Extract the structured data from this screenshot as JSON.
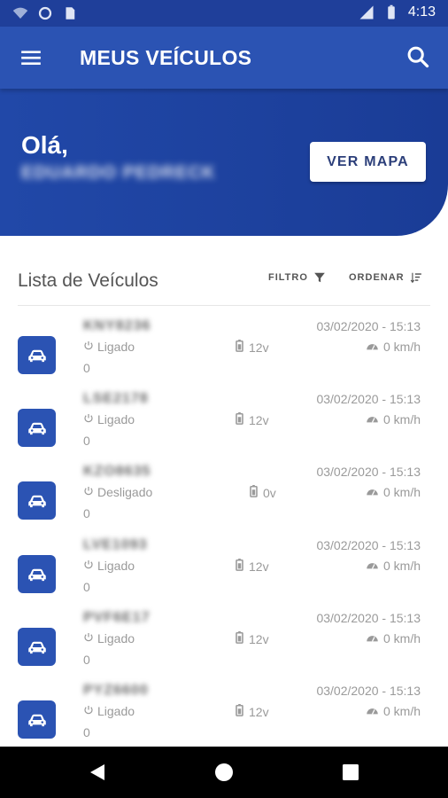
{
  "status_bar": {
    "time": "4:13",
    "left_icons": [
      "wifi-icon",
      "sync-icon",
      "sim-card-icon"
    ],
    "right_icons": [
      "signal-icon",
      "battery-icon"
    ]
  },
  "app_bar": {
    "title": "MEUS VEÍCULOS",
    "menu_icon": "menu-icon",
    "search_icon": "search-icon"
  },
  "hero": {
    "greeting": "Olá,",
    "user_name": "EDUARDO PEDRECK",
    "map_button": "VER MAPA"
  },
  "list": {
    "title": "Lista de Veículos",
    "filter_label": "FILTRO",
    "order_label": "ORDENAR",
    "vehicles": [
      {
        "plate": "KNY8236",
        "status": "Ligado",
        "value": "0",
        "voltage": "12v",
        "datetime": "03/02/2020 - 15:13",
        "speed": "0 km/h"
      },
      {
        "plate": "LSE2178",
        "status": "Ligado",
        "value": "0",
        "voltage": "12v",
        "datetime": "03/02/2020 - 15:13",
        "speed": "0 km/h"
      },
      {
        "plate": "KZO8635",
        "status": "Desligado",
        "value": "0",
        "voltage": "0v",
        "datetime": "03/02/2020 - 15:13",
        "speed": "0 km/h"
      },
      {
        "plate": "LVE1093",
        "status": "Ligado",
        "value": "0",
        "voltage": "12v",
        "datetime": "03/02/2020 - 15:13",
        "speed": "0 km/h"
      },
      {
        "plate": "PVF6E17",
        "status": "Ligado",
        "value": "0",
        "voltage": "12v",
        "datetime": "03/02/2020 - 15:13",
        "speed": "0 km/h"
      },
      {
        "plate": "PYZ6600",
        "status": "Ligado",
        "value": "0",
        "voltage": "12v",
        "datetime": "03/02/2020 - 15:13",
        "speed": "0 km/h"
      }
    ]
  },
  "colors": {
    "primary": "#2b53b3",
    "status_bar": "#1f3f9a",
    "hero": "#1a3c96",
    "muted_text": "#9a9a9a"
  },
  "nav_bar": {
    "icons": [
      "back-icon",
      "home-icon",
      "recents-icon"
    ]
  }
}
